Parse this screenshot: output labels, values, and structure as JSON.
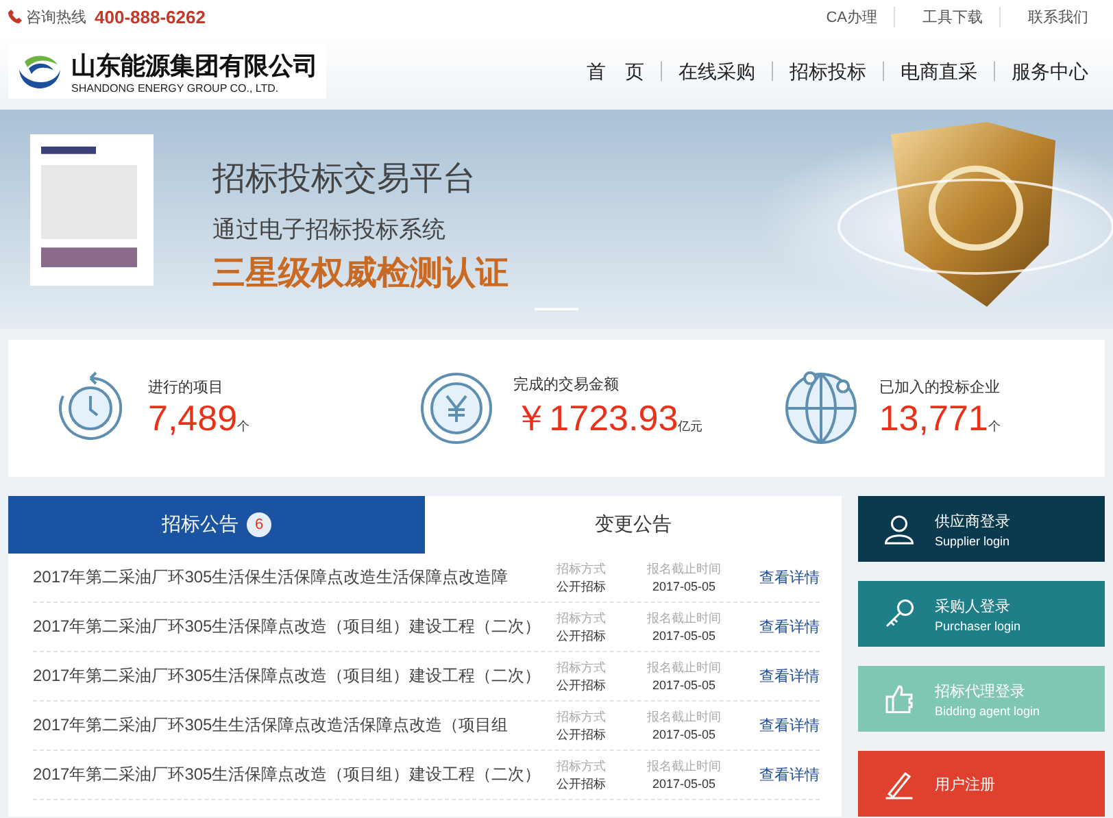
{
  "top_bar": {
    "hotline_label": "咨询热线",
    "hotline_number": "400-888-6262",
    "links": [
      "CA办理",
      "工具下载",
      "联系我们"
    ]
  },
  "header": {
    "logo": {
      "name_cn": "山东能源集团有限公司",
      "name_en": "SHANDONG ENERGY GROUP CO., LTD."
    },
    "nav": [
      "首　页",
      "在线采购",
      "招标投标",
      "电商直采",
      "服务中心"
    ]
  },
  "banner": {
    "title": "招标投标交易平台",
    "subtitle": "通过电子招标投标系统",
    "highlight": "三星级权威检测认证"
  },
  "stats": [
    {
      "kind": "clock",
      "label": "进行的项目",
      "value": "7,489",
      "unit": "个"
    },
    {
      "kind": "yen",
      "label": "完成的交易金额",
      "value": "￥1723.93",
      "unit": "亿元"
    },
    {
      "kind": "globe",
      "label": "已加入的投标企业",
      "value": "13,771",
      "unit": "个"
    }
  ],
  "notices": {
    "tabs": [
      {
        "label": "招标公告",
        "badge": "6",
        "selected": true
      },
      {
        "label": "变更公告",
        "selected": false
      }
    ],
    "rows": [
      {
        "title": "2017年第二采油厂环305生活保生活保障点改造生活保障点改造障",
        "method_label": "招标方式",
        "method": "公开招标",
        "deadline_label": "报名截止时间",
        "deadline": "2017-05-05",
        "link": "查看详情"
      },
      {
        "title": "2017年第二采油厂环305生活保障点改造（项目组）建设工程（二次）",
        "method_label": "招标方式",
        "method": "公开招标",
        "deadline_label": "报名截止时间",
        "deadline": "2017-05-05",
        "link": "查看详情"
      },
      {
        "title": "2017年第二采油厂环305生活保障点改造（项目组）建设工程（二次）",
        "method_label": "招标方式",
        "method": "公开招标",
        "deadline_label": "报名截止时间",
        "deadline": "2017-05-05",
        "link": "查看详情"
      },
      {
        "title": "2017年第二采油厂环305生生活保障点改造活保障点改造（项目组",
        "method_label": "招标方式",
        "method": "公开招标",
        "deadline_label": "报名截止时间",
        "deadline": "2017-05-05",
        "link": "查看详情"
      },
      {
        "title": "2017年第二采油厂环305生活保障点改造（项目组）建设工程（二次）",
        "method_label": "招标方式",
        "method": "公开招标",
        "deadline_label": "报名截止时间",
        "deadline": "2017-05-05",
        "link": "查看详情"
      }
    ]
  },
  "login_buttons": [
    {
      "kind": "user",
      "title": "供应商登录",
      "subtitle": "Supplier login",
      "color": "#0b3a4f"
    },
    {
      "kind": "key",
      "title": "采购人登录",
      "subtitle": "Purchaser login",
      "color": "#1f7f88"
    },
    {
      "kind": "thumb",
      "title": "招标代理登录",
      "subtitle": "Bidding agent login",
      "color": "#7fc7b3"
    },
    {
      "kind": "pen",
      "title": "用户注册",
      "color": "#e0412f"
    }
  ]
}
